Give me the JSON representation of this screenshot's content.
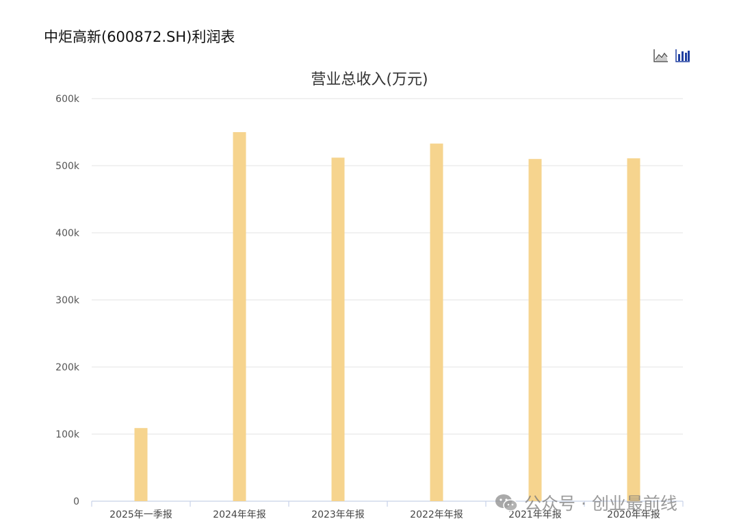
{
  "page": {
    "title": "中炬高新(600872.SH)利润表"
  },
  "toolbar": {
    "line_icon": "line-chart-icon",
    "bar_icon": "bar-chart-icon",
    "accent_color": "#1f3fa0"
  },
  "watermark": {
    "text": "公众号 · 创业最前线",
    "icon": "wechat-icon"
  },
  "chart_data": {
    "type": "bar",
    "title": "营业总收入(万元)",
    "xlabel": "",
    "ylabel": "",
    "categories": [
      "2025年一季报",
      "2024年年报",
      "2023年年报",
      "2022年年报",
      "2021年年报",
      "2020年年报"
    ],
    "series": [
      {
        "values": [
          109000,
          550000,
          512000,
          533000,
          510000,
          511000
        ]
      }
    ],
    "ylim": [
      0,
      600000
    ],
    "yticks": [
      0,
      100000,
      200000,
      300000,
      400000,
      500000,
      600000
    ],
    "ytick_labels": [
      "0",
      "100k",
      "200k",
      "300k",
      "400k",
      "500k",
      "600k"
    ],
    "grid": true,
    "bar_color": "#f6d48e"
  }
}
